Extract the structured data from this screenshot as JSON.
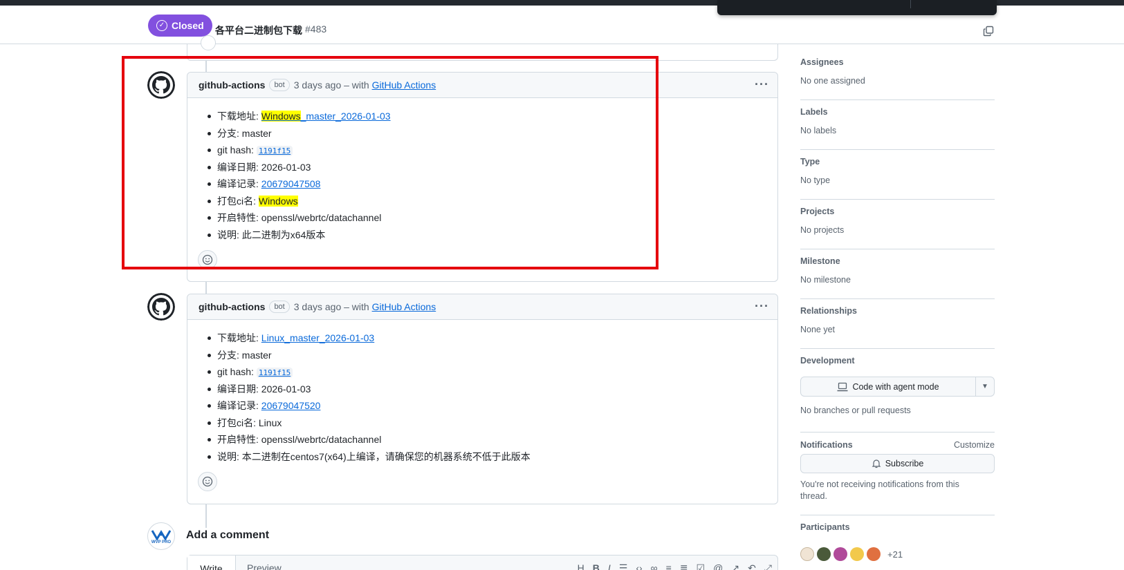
{
  "header": {
    "state": "Closed",
    "title": "各平台二进制包下载",
    "number": "#483"
  },
  "comments": [
    {
      "author": "github-actions",
      "badge": "bot",
      "time": "3 days ago – with",
      "app": "GitHub Actions",
      "items": {
        "download": {
          "label": "下载地址: ",
          "hl": "Windows",
          "rest": "_master_2026-01-03"
        },
        "branch": "分支: master",
        "hash_label": "git hash: ",
        "hash": "1191f15",
        "date": "编译日期: 2026-01-03",
        "record_label": "编译记录: ",
        "record": "20679047508",
        "ci_label": "打包ci名: ",
        "ci": "Windows",
        "features": "开启特性: openssl/webrtc/datachannel",
        "note": "说明: 此二进制为x64版本"
      }
    },
    {
      "author": "github-actions",
      "badge": "bot",
      "time": "3 days ago – with",
      "app": "GitHub Actions",
      "items": {
        "download_label": "下载地址: ",
        "download": "Linux_master_2026-01-03",
        "branch": "分支: master",
        "hash_label": "git hash: ",
        "hash": "1191f15",
        "date": "编译日期: 2026-01-03",
        "record_label": "编译记录: ",
        "record": "20679047520",
        "ci": "打包ci名: Linux",
        "features": "开启特性: openssl/webrtc/datachannel",
        "note": "说明: 本二进制在centos7(x64)上编译，请确保您的机器系统不低于此版本"
      }
    }
  ],
  "add_comment": {
    "title": "Add a comment",
    "avatar_text": "WVP PRO",
    "tab_write": "Write",
    "tab_preview": "Preview"
  },
  "sidebar": {
    "assignees": {
      "label": "Assignees",
      "value": "No one assigned"
    },
    "labels": {
      "label": "Labels",
      "value": "No labels"
    },
    "type": {
      "label": "Type",
      "value": "No type"
    },
    "projects": {
      "label": "Projects",
      "value": "No projects"
    },
    "milestone": {
      "label": "Milestone",
      "value": "No milestone"
    },
    "relationships": {
      "label": "Relationships",
      "value": "None yet"
    },
    "development": {
      "label": "Development",
      "button": "Code with agent mode",
      "value": "No branches or pull requests"
    },
    "notifications": {
      "label": "Notifications",
      "customize": "Customize",
      "button": "Subscribe",
      "value": "You're not receiving notifications from this thread."
    },
    "participants": {
      "label": "Participants",
      "more": "+21"
    }
  },
  "colors": {
    "closed_badge": "#8250df",
    "link": "#0969da",
    "highlight": "#ffff00",
    "annotation_box": "#e5000d"
  }
}
